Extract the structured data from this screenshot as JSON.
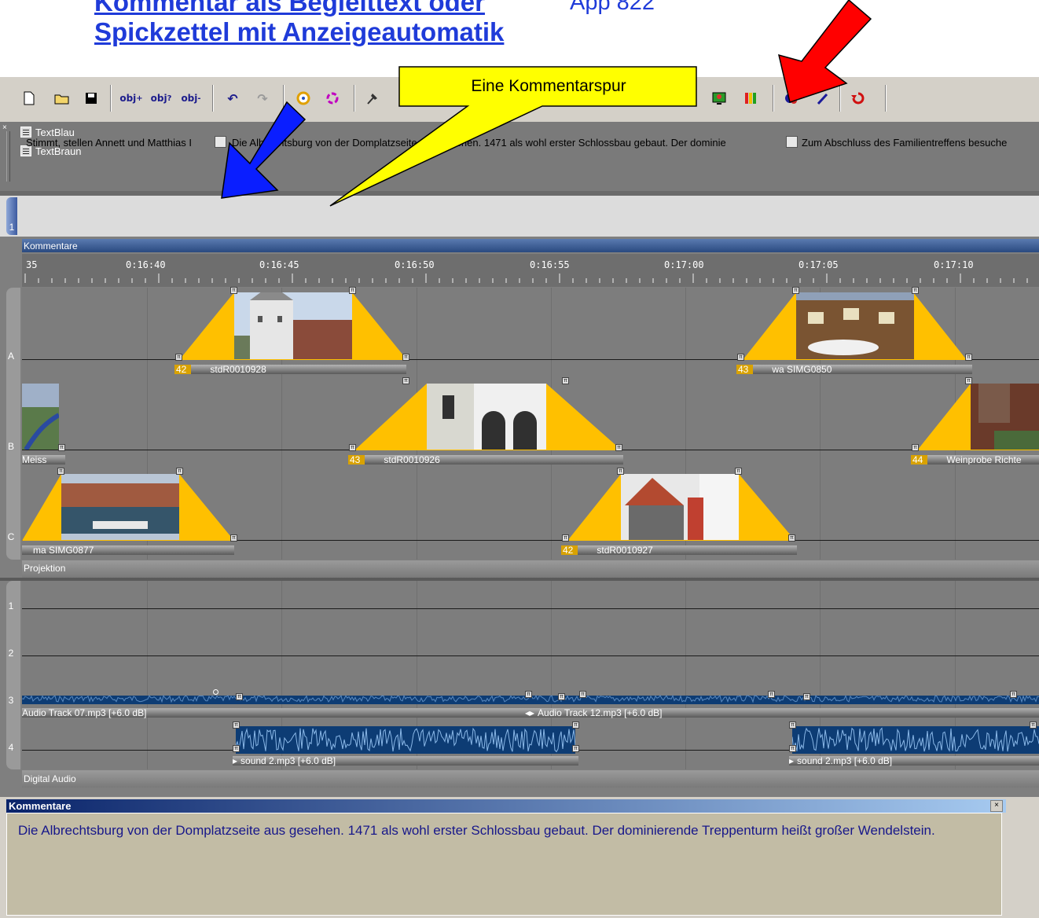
{
  "heading": {
    "line1": "Kommentar als Begleittext oder",
    "line1_extra": "App 822",
    "line2": "Spickzettel mit Anzeigeautomatik"
  },
  "callout": {
    "text": "Eine Kommentarspur"
  },
  "objects_panel": {
    "items": [
      "TextBlau",
      "TextBraun"
    ]
  },
  "comment_track": {
    "number": "1",
    "segments": [
      "Stimmt, stellen Annett und Matthias I",
      "Die Albrechtsburg von der Domplatzseite aus gesehen. 1471 als wohl erster Schlossbau gebaut. Der dominie",
      "Zum  Abschluss des Familientreffens besuche"
    ],
    "label": "Kommentare"
  },
  "ruler": {
    "labels": [
      "35",
      "0:16:40",
      "0:16:45",
      "0:16:50",
      "0:16:55",
      "0:17:00",
      "0:17:05",
      "0:17:10"
    ]
  },
  "projection": {
    "label": "Projektion",
    "tracks": [
      "A",
      "B",
      "C"
    ],
    "clips": [
      {
        "num": "42",
        "name": "stdR0010928"
      },
      {
        "num": "43",
        "name": "wa SIMG0850"
      },
      {
        "num": "",
        "name": "Meiss"
      },
      {
        "num": "43",
        "name": "stdR0010926"
      },
      {
        "num": "44",
        "name": "Weinprobe Richte"
      },
      {
        "num": "",
        "name": "ma SIMG0877"
      },
      {
        "num": "42",
        "name": "stdR0010927"
      }
    ]
  },
  "audio": {
    "label": "Digital Audio",
    "tracks": [
      "1",
      "2",
      "3",
      "4"
    ],
    "clips": [
      "Audio Track 07.mp3 [+6.0 dB]",
      "Audio Track 12.mp3 [+6.0 dB]",
      "sound 2.mp3 [+6.0 dB]",
      "sound 2.mp3 [+6.0 dB]"
    ]
  },
  "comment_panel": {
    "title": "Kommentare",
    "close": "×",
    "text": "Die Albrechtsburg von der Domplatzseite aus gesehen. 1471 als wohl erster Schlossbau gebaut. Der dominierende Treppenturm heißt großer Wendelstein."
  },
  "colors": {
    "heading": "#1f3bd9",
    "fade": "#ffc000",
    "callout": "#ffff00",
    "arrow_blue": "#0a1eff",
    "arrow_red": "#ff0000",
    "waveform": "#0d3c74",
    "panel_text": "#17178a"
  },
  "icons": [
    "new-icon",
    "open-icon",
    "save-icon",
    "add-object-icon",
    "object-info-icon",
    "remove-object-icon",
    "undo-icon",
    "redo-icon",
    "color-icon",
    "effects-icon",
    "tool-icon",
    "image-icon",
    "columns-icon",
    "record-icon",
    "wand-icon",
    "sync-icon"
  ]
}
